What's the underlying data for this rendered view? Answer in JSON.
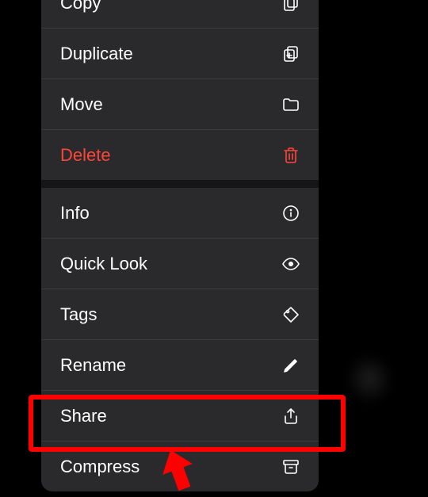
{
  "menu": {
    "groups": [
      [
        {
          "key": "copy",
          "label": "Copy",
          "icon": "copy-icon",
          "destructive": false
        },
        {
          "key": "duplicate",
          "label": "Duplicate",
          "icon": "duplicate-icon",
          "destructive": false
        },
        {
          "key": "move",
          "label": "Move",
          "icon": "folder-icon",
          "destructive": false
        },
        {
          "key": "delete",
          "label": "Delete",
          "icon": "trash-icon",
          "destructive": true
        }
      ],
      [
        {
          "key": "info",
          "label": "Info",
          "icon": "info-icon",
          "destructive": false
        },
        {
          "key": "quicklook",
          "label": "Quick Look",
          "icon": "eye-icon",
          "destructive": false
        },
        {
          "key": "tags",
          "label": "Tags",
          "icon": "tag-icon",
          "destructive": false
        },
        {
          "key": "rename",
          "label": "Rename",
          "icon": "pencil-icon",
          "destructive": false
        },
        {
          "key": "share",
          "label": "Share",
          "icon": "share-icon",
          "destructive": false
        },
        {
          "key": "compress",
          "label": "Compress",
          "icon": "archive-icon",
          "destructive": false
        }
      ]
    ]
  },
  "annotation": {
    "highlighted_item": "share",
    "cursor_color": "#ff0000",
    "highlight_color": "#ff0000"
  },
  "colors": {
    "background": "#000000",
    "menu_bg": "#2a2a2c",
    "text": "#ffffff",
    "destructive": "#ff453a",
    "separator": "#3d3d3f",
    "group_separator": "#151517"
  }
}
